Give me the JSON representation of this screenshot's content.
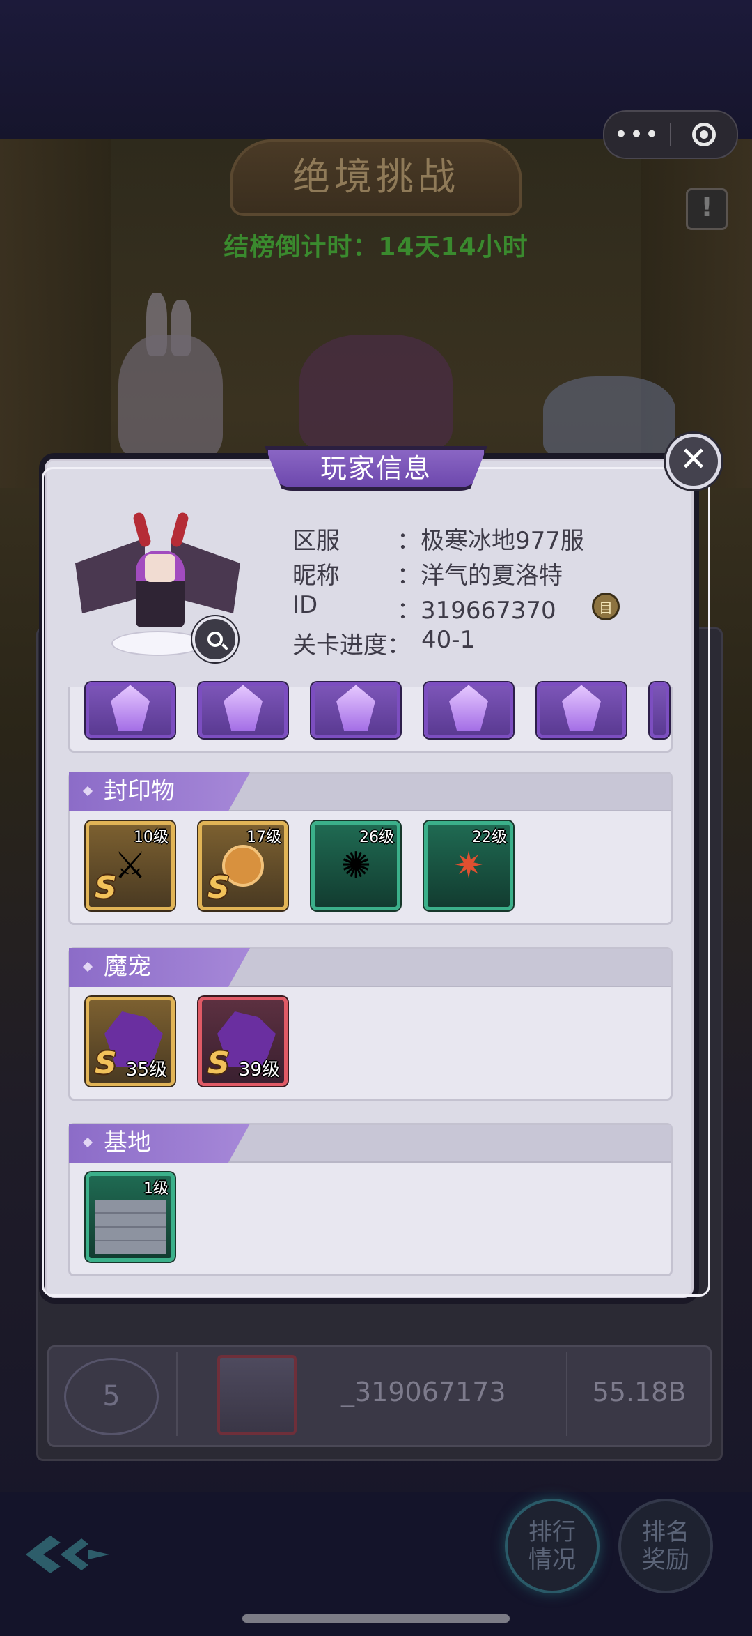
{
  "top_capsule": {
    "more_glyph": "•••",
    "target_icon": "target-icon"
  },
  "header": {
    "title": "绝境挑战",
    "info_glyph": "!",
    "countdown": "结榜倒计时：14天14小时"
  },
  "background_row": {
    "rank": "5",
    "name": "_319067173",
    "value": "55.18B"
  },
  "bottom_buttons": {
    "ranking_status": "排行\n情况",
    "ranking_rewards": "排名\n奖励"
  },
  "modal": {
    "title": "玩家信息",
    "close_glyph": "✕",
    "fields": [
      {
        "label": "区服",
        "value": "：极寒冰地977服"
      },
      {
        "label": "昵称",
        "value": "：洋气的夏洛特"
      },
      {
        "label": "ID",
        "value": "：319667370"
      },
      {
        "label": "关卡进度：",
        "value": "40-1"
      }
    ],
    "copy_glyph": "目",
    "sections": {
      "seals": {
        "title": "封印物",
        "items": [
          {
            "level": "10级",
            "grade": "S",
            "icon": "crossed-swords-icon",
            "frame": "gold"
          },
          {
            "level": "17级",
            "grade": "S",
            "icon": "coin-icon",
            "frame": "gold"
          },
          {
            "level": "26级",
            "grade": "",
            "icon": "fireworks-flower-icon",
            "frame": "green"
          },
          {
            "level": "22级",
            "grade": "",
            "icon": "star-burst-icon",
            "frame": "green"
          }
        ]
      },
      "pets": {
        "title": "魔宠",
        "items": [
          {
            "level": "35级",
            "grade": "S",
            "icon": "purple-dragon-icon",
            "frame": "gold"
          },
          {
            "level": "39级",
            "grade": "S",
            "icon": "purple-dragon-icon",
            "frame": "red"
          }
        ]
      },
      "base": {
        "title": "基地",
        "items": [
          {
            "level": "1级",
            "grade": "",
            "icon": "stone-wall-icon",
            "frame": "green"
          }
        ]
      }
    }
  }
}
